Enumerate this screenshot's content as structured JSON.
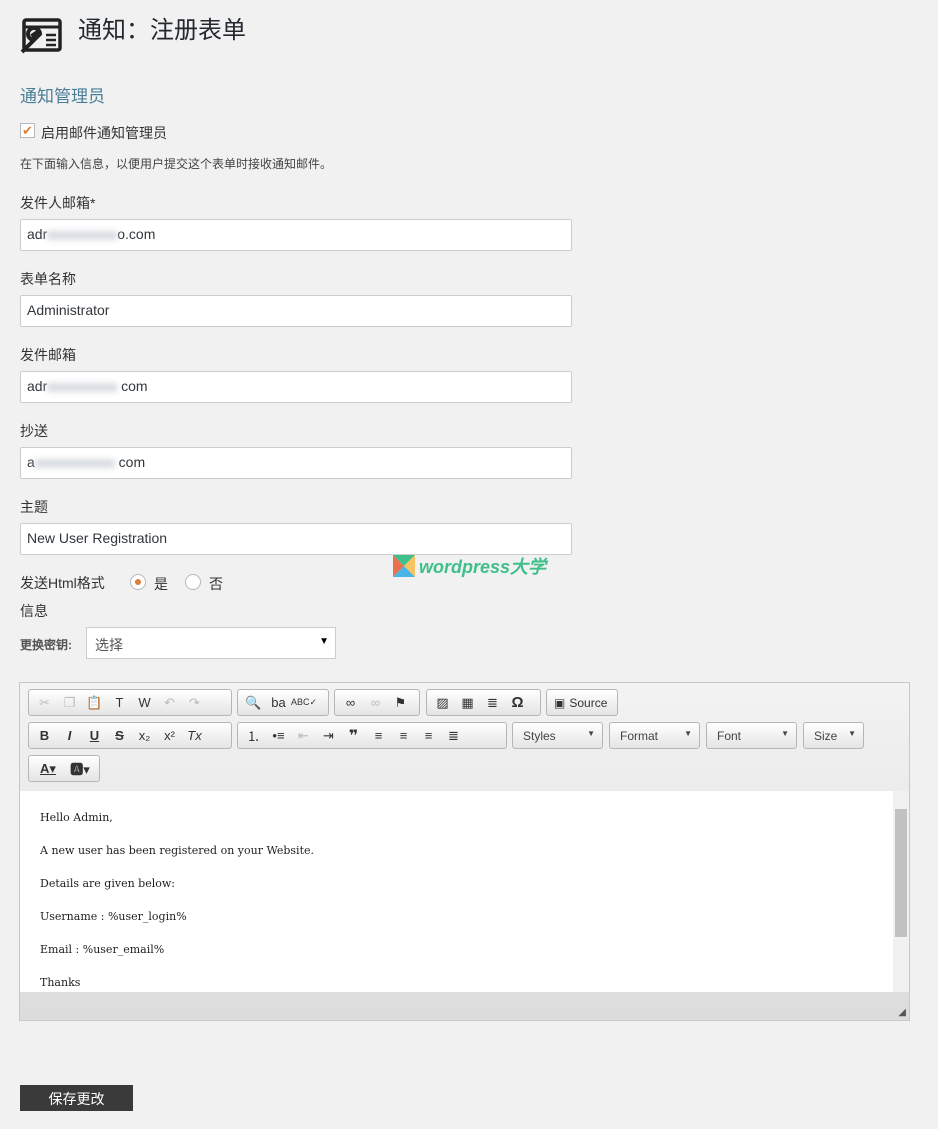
{
  "header": {
    "title": "通知：注册表单",
    "icon": "form-wrench-icon"
  },
  "section": {
    "title": "通知管理员",
    "enable_label": "启用邮件通知管理员",
    "enable_checked": true,
    "help": "在下面输入信息，以便用户提交这个表单时接收通知邮件。"
  },
  "fields": [
    {
      "label": "发件人邮箱*",
      "prefix": "adr",
      "suffix": "o.com",
      "blurred": true
    },
    {
      "label": "表单名称",
      "value": "Administrator"
    },
    {
      "label": "发件邮箱",
      "prefix": "adr",
      "suffix": " com",
      "blurred": true
    },
    {
      "label": "抄送",
      "prefix": "a",
      "suffix": " com",
      "blurred": true
    },
    {
      "label": "主题",
      "value": "New User Registration"
    }
  ],
  "html_format": {
    "label": "发送Html格式",
    "yes": "是",
    "no": "否",
    "selected": "是"
  },
  "message": {
    "label": "信息",
    "key_label": "更换密钥:",
    "select_value": "选择"
  },
  "watermark": "wordpress大学",
  "toolbar": {
    "source": "Source",
    "styles": "Styles",
    "format": "Format",
    "font": "Font",
    "size": "Size"
  },
  "editor_content": [
    "Hello Admin,",
    "A new user has been registered on your Website.",
    "Details are given below:",
    "Username : %user_login%",
    "Email : %user_email%",
    "Thanks"
  ],
  "save_label": "保存更改",
  "colors": {
    "accent": "#e07b39",
    "heading": "#4a7e96",
    "button": "#3a3a3a"
  }
}
